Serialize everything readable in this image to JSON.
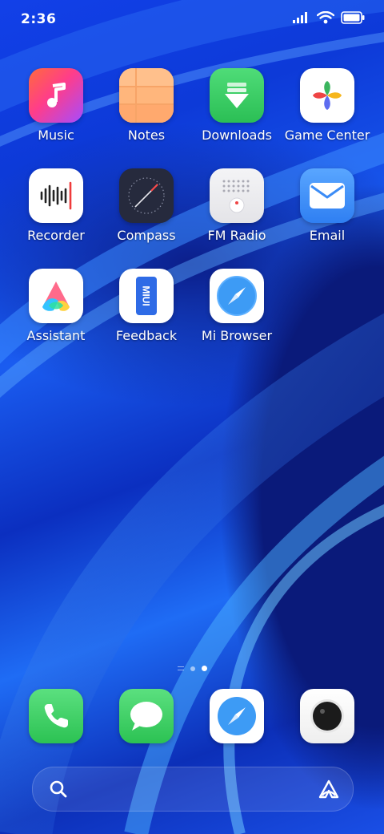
{
  "status_bar": {
    "time": "2:36",
    "icons": [
      "signal-icon",
      "wifi-icon",
      "battery-icon"
    ]
  },
  "apps": [
    {
      "label": "Music",
      "icon": "music-note-icon"
    },
    {
      "label": "Notes",
      "icon": "notes-icon"
    },
    {
      "label": "Downloads",
      "icon": "download-arrow-icon"
    },
    {
      "label": "Game Center",
      "icon": "pinwheel-icon"
    },
    {
      "label": "Recorder",
      "icon": "sound-wave-icon"
    },
    {
      "label": "Compass",
      "icon": "compass-dial-icon"
    },
    {
      "label": "FM Radio",
      "icon": "radio-icon"
    },
    {
      "label": "Email",
      "icon": "envelope-icon"
    },
    {
      "label": "Assistant",
      "icon": "assistant-logo-icon"
    },
    {
      "label": "Feedback",
      "icon": "miui-feedback-icon",
      "icon_text": "MIUI"
    },
    {
      "label": "Mi Browser",
      "icon": "compass-needle-icon"
    }
  ],
  "page_indicator": {
    "pages": 3,
    "current": 3
  },
  "dock": [
    {
      "icon": "phone-icon"
    },
    {
      "icon": "message-bubble-icon"
    },
    {
      "icon": "browser-icon"
    },
    {
      "icon": "camera-icon"
    }
  ],
  "search_bar": {
    "left_icon": "search-icon",
    "right_icon": "assistant-icon"
  },
  "colors": {
    "wallpaper_dark": "#0a1a7a",
    "wallpaper_bright": "#1f6cf5",
    "green_app": "#34c759",
    "email_blue": "#3b8cf6"
  }
}
